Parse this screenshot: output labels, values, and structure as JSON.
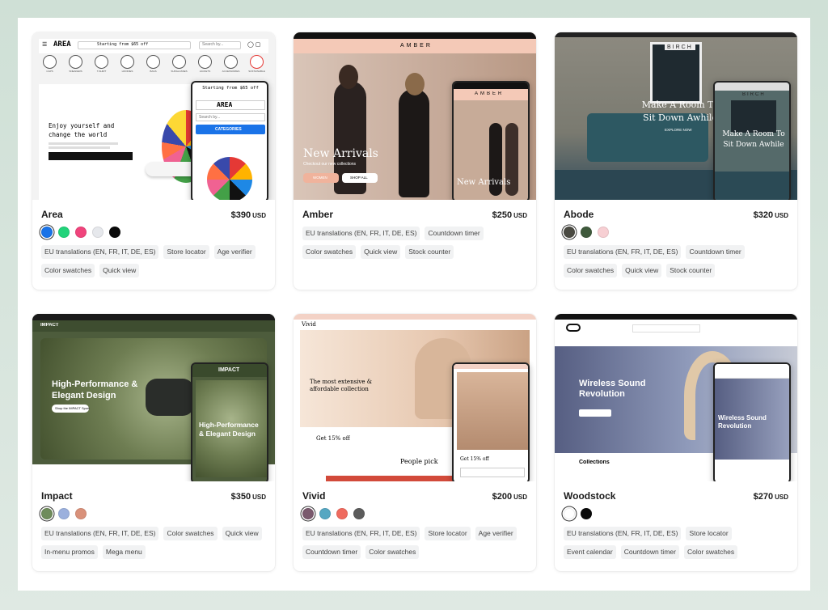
{
  "themes": [
    {
      "name": "Area",
      "price": "$390",
      "currency": "USD",
      "swatches": [
        "#1a73e8",
        "#22d37a",
        "#f0447c",
        "#e6e8ec",
        "#0a0a0a"
      ],
      "tags": [
        "EU translations (EN, FR, IT, DE, ES)",
        "Store locator",
        "Age verifier",
        "Color swatches",
        "Quick view"
      ],
      "preview": {
        "logo": "AREA",
        "announcement": "Starting from $65 off",
        "search": "Search by...",
        "headline": "Enjoy yourself and change the world",
        "categories": [
          "CAPS",
          "SNEAKERS",
          "T-SHIRT",
          "HOODIES",
          "BAGS",
          "SUNGLASSES",
          "JACKETS",
          "ACCESSORIES",
          "SUSTAINABLE"
        ],
        "mobile_announcement": "Starting from $65 off",
        "mobile_logo": "AREA",
        "mobile_search": "Search by...",
        "mobile_button": "CATEGORIES"
      }
    },
    {
      "name": "Amber",
      "price": "$250",
      "currency": "USD",
      "swatches": [],
      "tags": [
        "EU translations (EN, FR, IT, DE, ES)",
        "Countdown timer",
        "Color swatches",
        "Quick view",
        "Stock counter"
      ],
      "preview": {
        "logo": "AMBER",
        "headline": "New Arrivals",
        "sub": "Checkout our new collections",
        "btn1": "WOMEN",
        "btn2": "SHOP ALL",
        "mobile_logo": "AMBER",
        "mobile_headline": "New Arrivals"
      }
    },
    {
      "name": "Abode",
      "price": "$320",
      "currency": "USD",
      "swatches": [
        "#4a4a42",
        "#3f5a3c",
        "#f7cfd3"
      ],
      "tags": [
        "EU translations (EN, FR, IT, DE, ES)",
        "Countdown timer",
        "Color swatches",
        "Quick view",
        "Stock counter"
      ],
      "preview": {
        "logo": "BIRCH",
        "headline": "Make A Room To Sit Down Awhile",
        "cta": "EXPLORE NOW",
        "mobile_logo": "BIRCH",
        "mobile_headline": "Make A Room To Sit Down Awhile"
      }
    },
    {
      "name": "Impact",
      "price": "$350",
      "currency": "USD",
      "swatches": [
        "#6f8c5c",
        "#9bb0dd",
        "#d9917a"
      ],
      "tags": [
        "EU translations (EN, FR, IT, DE, ES)",
        "Color swatches",
        "Quick view",
        "In-menu promos",
        "Mega menu"
      ],
      "preview": {
        "logo": "IMPACT",
        "headline": "High-Performance & Elegant Design",
        "cta": "Shop the IMPACT Sport",
        "mobile_logo": "IMPACT",
        "mobile_headline": "High-Performance & Elegant Design"
      }
    },
    {
      "name": "Vivid",
      "price": "$200",
      "currency": "USD",
      "swatches": [
        "#7a5a6e",
        "#56a7c2",
        "#ef6b5f",
        "#5c5c5c"
      ],
      "tags": [
        "EU translations (EN, FR, IT, DE, ES)",
        "Store locator",
        "Age verifier",
        "Countdown timer",
        "Color swatches"
      ],
      "preview": {
        "logo": "Vivid",
        "headline": "The most extensive & affordable collection",
        "promo": "Get 15% off",
        "section": "People pick",
        "mobile_promo": "Get 15% off"
      }
    },
    {
      "name": "Woodstock",
      "price": "$270",
      "currency": "USD",
      "swatches": [
        "#ffffff",
        "#0a0a0a"
      ],
      "tags": [
        "EU translations (EN, FR, IT, DE, ES)",
        "Store locator",
        "Event calendar",
        "Countdown timer",
        "Color swatches"
      ],
      "preview": {
        "headline": "Wireless Sound Revolution",
        "section": "Collections",
        "mobile_headline": "Wireless Sound Revolution"
      }
    }
  ]
}
